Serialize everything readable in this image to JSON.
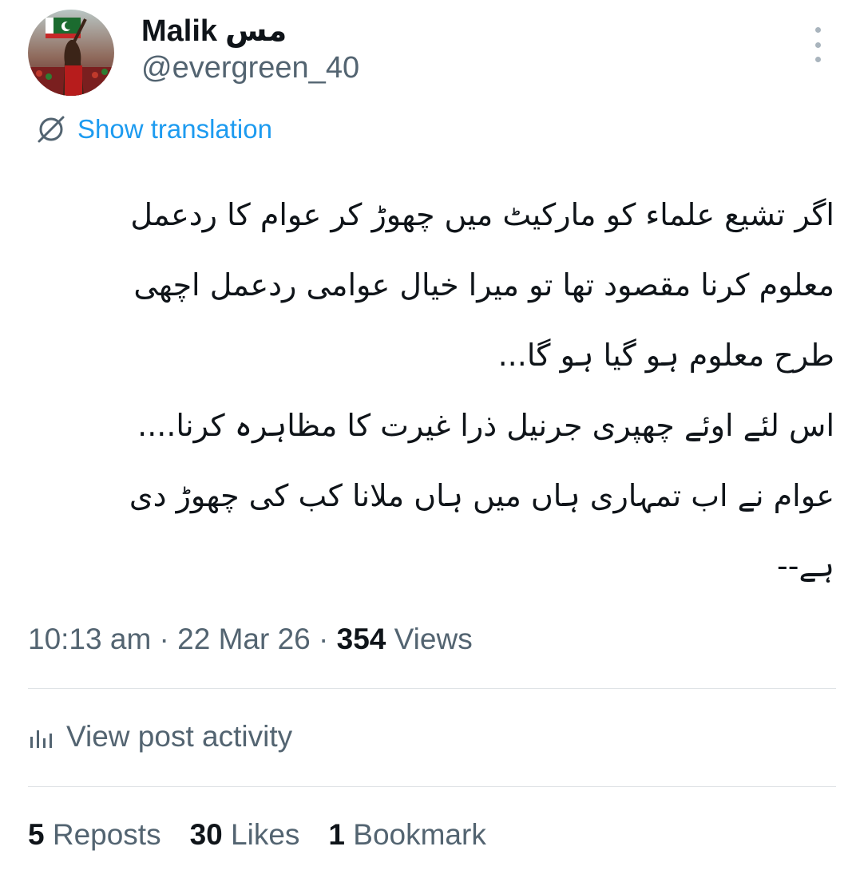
{
  "author": {
    "display_name": "Malik",
    "name_suffix": "مس",
    "handle": "@evergreen_40",
    "avatar_alt": "profile photo"
  },
  "translation": {
    "label": "Show translation",
    "icon": "no-translate-icon"
  },
  "post": {
    "lines": [
      "اگر تشیع علماء کو مارکیٹ میں چھوڑ کر عوام کا ردعمل",
      "معلوم کرنا مقصود تھا تو میرا خیال عوامی ردعمل اچھی",
      "طرح معلوم ہو گیا ہو گا...",
      "اس لئے اوئے چھپری جرنیل ذرا غیرت کا مظاہرہ کرنا....",
      "عوام نے اب تمہاری ہاں میں ہاں ملانا کب کی چھوڑ دی",
      "ہے--"
    ]
  },
  "meta": {
    "time": "10:13 am",
    "sep1": " · ",
    "date": "22 Mar 26",
    "sep2": " · ",
    "views_count": "354",
    "views_label": " Views"
  },
  "activity": {
    "label": "View post activity",
    "icon": "bar-chart-icon"
  },
  "stats": {
    "reposts_count": "5",
    "reposts_label": " Reposts",
    "likes_count": "30",
    "likes_label": " Likes",
    "bookmarks_count": "1",
    "bookmarks_label": " Bookmark"
  },
  "colors": {
    "accent": "#1d9bf0",
    "muted": "#536471",
    "text": "#0f1419",
    "divider": "#dfe3e6"
  }
}
